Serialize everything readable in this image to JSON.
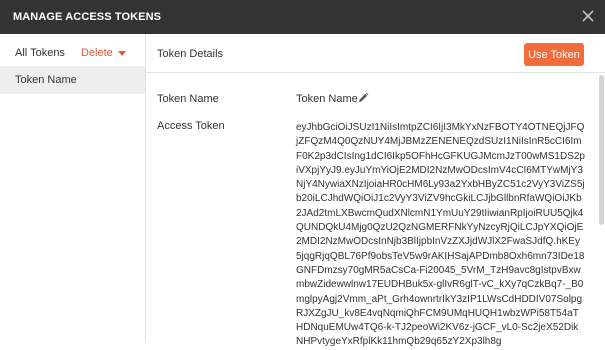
{
  "window": {
    "title": "MANAGE ACCESS TOKENS",
    "close_icon": "close-icon"
  },
  "sidebar": {
    "header_label": "All Tokens",
    "delete_label": "Delete",
    "dropdown_icon": "caret-down-icon",
    "items": [
      {
        "label": "Token Name",
        "selected": true
      }
    ]
  },
  "main": {
    "title": "Token Details",
    "use_button_label": "Use Token",
    "fields": {
      "token_name_label": "Token Name",
      "token_name_value": "Token Name",
      "edit_icon": "pencil-icon",
      "access_token_label": "Access Token",
      "access_token_value": "eyJhbGciOiJSUzI1NiIsImtpZCI6IjI3MkYxNzFBOTY4OTNEQjJFQjZFQzM4Q0QzNUY4MjJBMzZENENEQzdSUzI1NiIsInR5cCI6ImF0K2p3dCIsIng1dCI6Ikp5OFhHcGFKUGJMcmJzT00wMS1DS2piVXpjYyJ9.eyJuYmYiOjE2MDI2NzMwODcsImV4cCI6MTYwMjY3NjY4NywiaXNzIjoiaHR0cHM6Ly93a2YxbHByZC51c2VyY3ViZS5jb20iLCJhdWQiOiJ1c2VyY3ViZV9hcGkiLCJjbGllbnRfaWQiOiJKb2JAd2tmLXBwcmQudXNlcmN1YmUuY29tIiwianRpIjoiRUU5Qjk4QUNDQkU4Mjg0QzU2QzNGMERFNkYyNzcyRjQiLCJpYXQiOjE2MDI2NzMwODcsInNjb3BlIjpbInVzZXJjdWJlX2FwaSJdfQ.hKEy5jqgRjqQBL76Pf9obsTeV5w9rAKIHSajAPDmb8Oxh6mn73IDe18GNFDmzsy70gMR5aCsCa-Fi20045_5VrM_TzH9avc8gIstpvBxwmbwZidewwlnw17EUDHBuk5x-glIvR6glT-vC_kXy7qCzkBq7-_B0mglpyAgj2Vmm_aPt_Grh4ownrtrIkY3zIP1LWsCdHDDIV07SolpgRJXZgJU_kv8E4vqNqmiQhFCM9UMqHUQH1wbzWPi58T54aTHDNquEMUw4TQ6-k-TJ2peoWi2KV6z-jGCF_vL0-Sc2jeX52DikNHPvtygeYxRfplKk11hmQb29q65zY2Xp3lh8g"
    }
  },
  "colors": {
    "titlebar_bg": "#333333",
    "accent": "#f26b3a",
    "delete_text": "#e8583b",
    "selected_item_bg": "#eeeeee"
  }
}
